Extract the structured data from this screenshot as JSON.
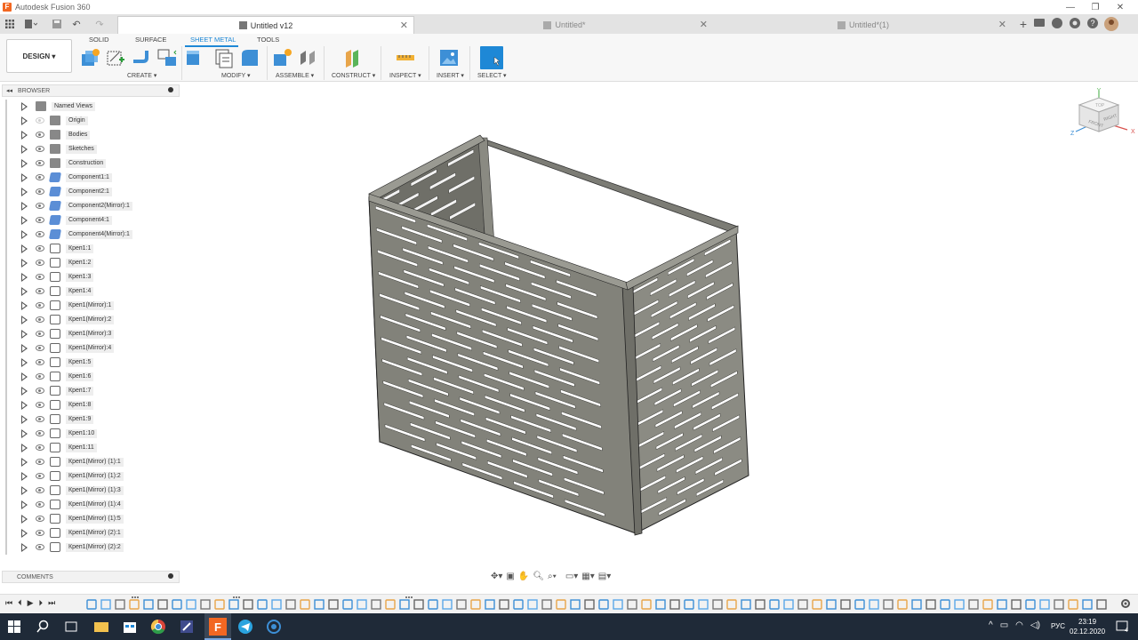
{
  "window": {
    "title": "Autodesk Fusion 360",
    "controls": [
      "—",
      "❐",
      "✕"
    ]
  },
  "tabs": [
    {
      "label": "Untitled v12",
      "active": true
    },
    {
      "label": "Untitled*",
      "active": false
    },
    {
      "label": "Untitled*(1)",
      "active": false
    }
  ],
  "workspace": {
    "label": "DESIGN ▾"
  },
  "ribbon_tabs": [
    "SOLID",
    "SURFACE",
    "SHEET METAL",
    "TOOLS"
  ],
  "ribbon_groups": [
    "CREATE ▾",
    "MODIFY ▾",
    "ASSEMBLE ▾",
    "CONSTRUCT ▾",
    "INSPECT ▾",
    "INSERT ▾",
    "SELECT ▾"
  ],
  "browser": {
    "title": "BROWSER",
    "items": [
      {
        "label": "Named Views",
        "icon": "folder"
      },
      {
        "label": "Origin",
        "icon": "folder",
        "dim": true
      },
      {
        "label": "Bodies",
        "icon": "folder"
      },
      {
        "label": "Sketches",
        "icon": "folder"
      },
      {
        "label": "Construction",
        "icon": "folder"
      },
      {
        "label": "Component1:1",
        "icon": "comp"
      },
      {
        "label": "Component2:1",
        "icon": "comp"
      },
      {
        "label": "Component2(Mirror):1",
        "icon": "comp"
      },
      {
        "label": "Component4:1",
        "icon": "comp"
      },
      {
        "label": "Component4(Mirror):1",
        "icon": "comp"
      },
      {
        "label": "Креп1:1",
        "icon": "body"
      },
      {
        "label": "Креп1:2",
        "icon": "body"
      },
      {
        "label": "Креп1:3",
        "icon": "body"
      },
      {
        "label": "Креп1:4",
        "icon": "body"
      },
      {
        "label": "Креп1(Mirror):1",
        "icon": "body"
      },
      {
        "label": "Креп1(Mirror):2",
        "icon": "body"
      },
      {
        "label": "Креп1(Mirror):3",
        "icon": "body"
      },
      {
        "label": "Креп1(Mirror):4",
        "icon": "body"
      },
      {
        "label": "Креп1:5",
        "icon": "body"
      },
      {
        "label": "Креп1:6",
        "icon": "body"
      },
      {
        "label": "Креп1:7",
        "icon": "body"
      },
      {
        "label": "Креп1:8",
        "icon": "body"
      },
      {
        "label": "Креп1:9",
        "icon": "body"
      },
      {
        "label": "Креп1:10",
        "icon": "body"
      },
      {
        "label": "Креп1:11",
        "icon": "body"
      },
      {
        "label": "Креп1(Mirror) (1):1",
        "icon": "body"
      },
      {
        "label": "Креп1(Mirror) (1):2",
        "icon": "body"
      },
      {
        "label": "Креп1(Mirror) (1):3",
        "icon": "body"
      },
      {
        "label": "Креп1(Mirror) (1):4",
        "icon": "body"
      },
      {
        "label": "Креп1(Mirror) (1):5",
        "icon": "body"
      },
      {
        "label": "Креп1(Mirror) (2):1",
        "icon": "body"
      },
      {
        "label": "Креп1(Mirror) (2):2",
        "icon": "body"
      }
    ]
  },
  "comments": {
    "title": "COMMENTS"
  },
  "viewcube": {
    "front": "FRONT",
    "right": "RIGHT",
    "top": "TOP",
    "axes": [
      "Y",
      "X",
      "Z"
    ]
  },
  "taskbar": {
    "time": "23:19",
    "date": "02.12.2020",
    "lang": "РУС"
  },
  "colors": {
    "accent": "#1e88d6",
    "metal": "#808078"
  }
}
